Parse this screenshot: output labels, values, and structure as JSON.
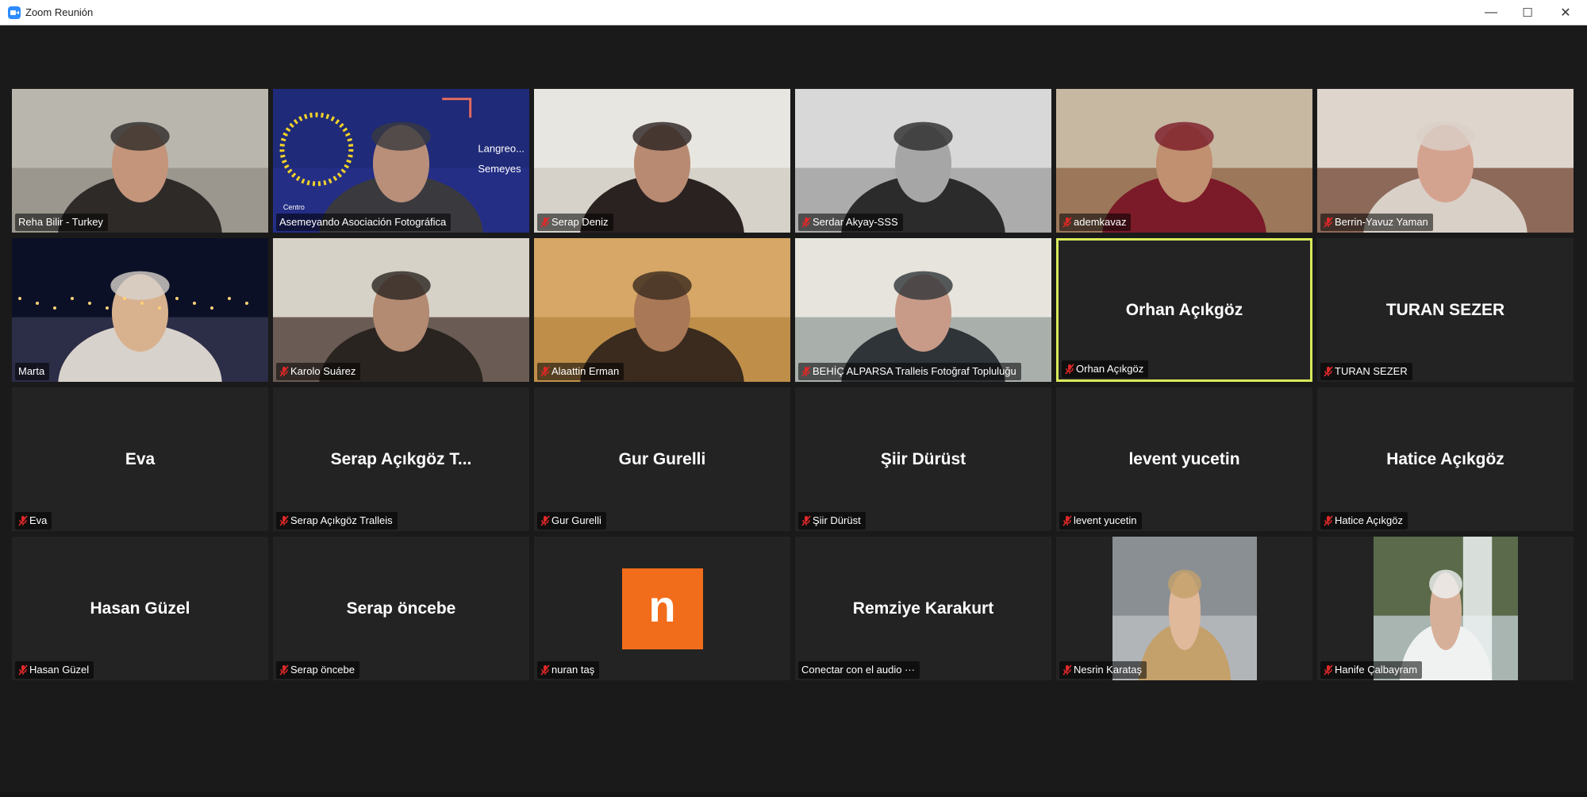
{
  "window": {
    "title": "Zoom Reunión"
  },
  "controls": {
    "minimize": "—",
    "maximize": "☐",
    "close": "✕"
  },
  "participants": [
    {
      "label": "Reha Bilir - Turkey",
      "video": true,
      "muted": false,
      "scene": "man-room"
    },
    {
      "label": "Asemeyando Asociación Fotográfica",
      "video": true,
      "muted": false,
      "scene": "blue-banner",
      "banner_text": [
        "Langreo...",
        "Semeyes",
        "Centro"
      ]
    },
    {
      "label": "Serap Deniz",
      "video": true,
      "muted": true,
      "scene": "kitchen"
    },
    {
      "label": "Serdar Akyay-SSS",
      "video": true,
      "muted": true,
      "scene": "bw-portrait"
    },
    {
      "label": "ademkavaz",
      "video": true,
      "muted": true,
      "scene": "man-red"
    },
    {
      "label": "Berrin-Yavuz Yaman",
      "video": true,
      "muted": true,
      "scene": "man-door"
    },
    {
      "label": "Marta",
      "video": true,
      "muted": false,
      "scene": "night-harbor"
    },
    {
      "label": "Karolo Suárez",
      "video": true,
      "muted": true,
      "scene": "man-dark"
    },
    {
      "label": "Alaattin Erman",
      "video": true,
      "muted": true,
      "scene": "man-warm"
    },
    {
      "label": "BEHİÇ ALPARSA   Tralleis Fotoğraf Topluluğu",
      "video": true,
      "muted": true,
      "scene": "man-grey"
    },
    {
      "label": "Orhan Açıkgöz",
      "name": "Orhan Açıkgöz",
      "video": false,
      "muted": true,
      "active": true
    },
    {
      "label": "TURAN SEZER",
      "name": "TURAN SEZER",
      "video": false,
      "muted": true
    },
    {
      "label": "Eva",
      "name": "Eva",
      "video": false,
      "muted": true
    },
    {
      "label": "Serap Açıkgöz  Tralleis",
      "name": "Serap Açıkgöz  T...",
      "video": false,
      "muted": true
    },
    {
      "label": "Gur Gurelli",
      "name": "Gur Gurelli",
      "video": false,
      "muted": true
    },
    {
      "label": "Şiir Dürüst",
      "name": "Şiir Dürüst",
      "video": false,
      "muted": true
    },
    {
      "label": "levent yucetin",
      "name": "levent yucetin",
      "video": false,
      "muted": true
    },
    {
      "label": "Hatice Açıkgöz",
      "name": "Hatice Açıkgöz",
      "video": false,
      "muted": true
    },
    {
      "label": "Hasan Güzel",
      "name": "Hasan Güzel",
      "video": false,
      "muted": true
    },
    {
      "label": "Serap öncebe",
      "name": "Serap öncebe",
      "video": false,
      "muted": true
    },
    {
      "label": "nuran taş",
      "avatar": "n",
      "video": false,
      "muted": true
    },
    {
      "label": "Conectar con el audio ···",
      "name": "Remziye Karakurt",
      "video": false,
      "muted": false
    },
    {
      "label": "Nesrin Karataş",
      "video": false,
      "muted": true,
      "photo": "woman-curly"
    },
    {
      "label": "Hanife Çalbayram",
      "video": false,
      "muted": true,
      "photo": "waterfall"
    }
  ],
  "colors": {
    "active_border": "#d9ea5b",
    "avatar_bg": "#f26d1b",
    "mute_icon": "#e02828",
    "background": "#1a1a1a",
    "tile": "#232323"
  }
}
